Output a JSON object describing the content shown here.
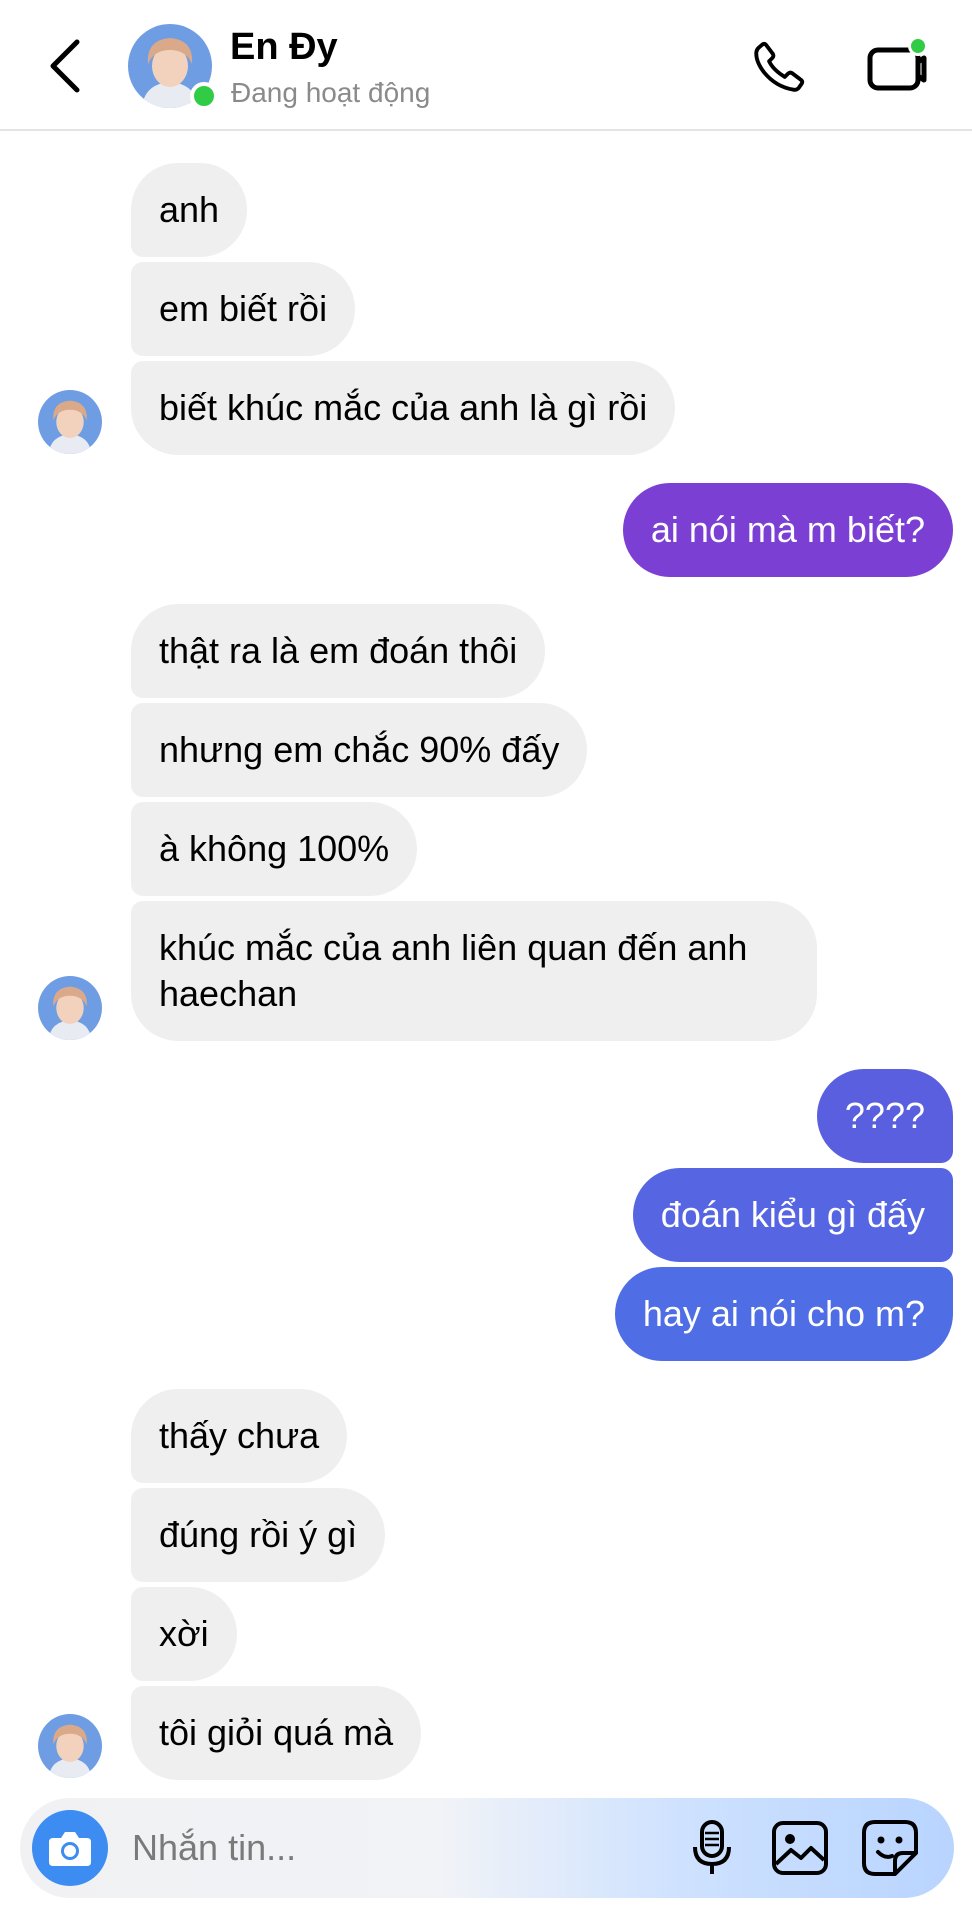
{
  "header": {
    "name": "En Đy",
    "status": "Đang hoạt động"
  },
  "messages": [
    {
      "side": "received",
      "text": "anh"
    },
    {
      "side": "received",
      "text": "em biết rồi"
    },
    {
      "side": "received",
      "text": "biết khúc mắc của anh là gì rồi"
    },
    {
      "side": "sent",
      "text": "ai nói mà m biết?"
    },
    {
      "side": "received",
      "text": "thật ra là em đoán thôi"
    },
    {
      "side": "received",
      "text": "nhưng em chắc 90% đấy"
    },
    {
      "side": "received",
      "text": "à không 100%"
    },
    {
      "side": "received",
      "text": "khúc mắc của anh liên quan đến anh haechan"
    },
    {
      "side": "sent",
      "text": "????"
    },
    {
      "side": "sent",
      "text": "đoán kiểu gì đấy"
    },
    {
      "side": "sent",
      "text": "hay ai nói cho m?"
    },
    {
      "side": "received",
      "text": "thấy chưa"
    },
    {
      "side": "received",
      "text": "đúng rồi ý gì"
    },
    {
      "side": "received",
      "text": "xời"
    },
    {
      "side": "received",
      "text": "tôi giỏi quá mà"
    }
  ],
  "composer": {
    "placeholder": "Nhắn tin..."
  },
  "icons": {
    "back": "chevron-left-icon",
    "call": "phone-icon",
    "video": "video-call-icon",
    "camera": "camera-icon",
    "mic": "microphone-icon",
    "gallery": "image-icon",
    "sticker": "sticker-icon"
  },
  "colors": {
    "received_bubble": "#efefef",
    "sent_purple": "#7b3fd4",
    "sent_blue": "#5168e3",
    "online": "#31cc46",
    "camera_button": "#3c8cf2"
  }
}
